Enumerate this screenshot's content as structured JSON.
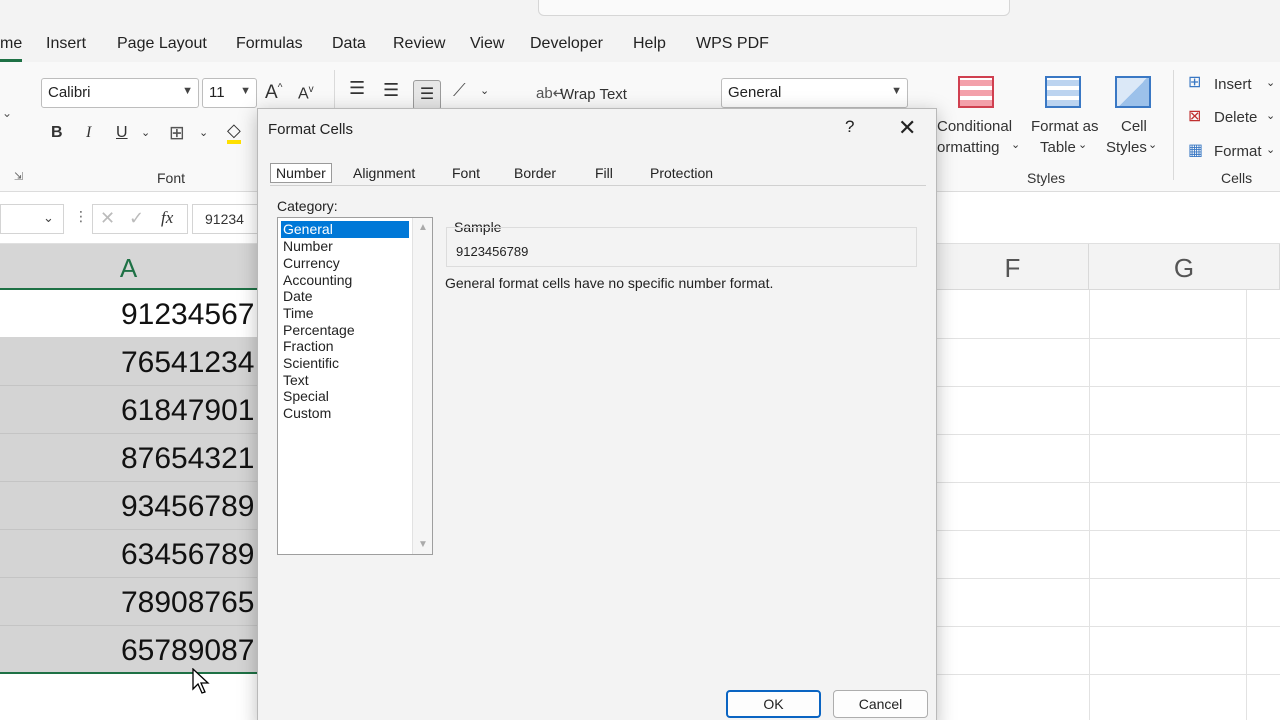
{
  "menu": {
    "tabs": [
      "me",
      "Insert",
      "Page Layout",
      "Formulas",
      "Data",
      "Review",
      "View",
      "Developer",
      "Help",
      "WPS PDF"
    ]
  },
  "ribbon": {
    "font_name": "Calibri",
    "font_size": "11",
    "bold": "B",
    "italic": "I",
    "underline": "U",
    "font_group_label": "Font",
    "wrap_text": "Wrap Text",
    "number_format": "General",
    "conditional_formatting_line1": "Conditional",
    "conditional_formatting_line2": "ormatting",
    "format_as_table_line1": "Format as",
    "format_as_table_line2": "Table",
    "cell_styles_line1": "Cell",
    "cell_styles_line2": "Styles",
    "styles_group_label": "Styles",
    "insert": "Insert",
    "delete": "Delete",
    "format": "Format",
    "cells_group_label": "Cells"
  },
  "formula_bar": {
    "fx": "fx",
    "value": "91234"
  },
  "grid": {
    "column_a": "A",
    "column_f": "F",
    "column_g": "G",
    "cells": [
      "91234567",
      "76541234",
      "61847901",
      "87654321",
      "93456789",
      "63456789",
      "78908765",
      "65789087"
    ]
  },
  "dialog": {
    "title": "Format Cells",
    "help": "?",
    "close": "✕",
    "tabs": [
      "Number",
      "Alignment",
      "Font",
      "Border",
      "Fill",
      "Protection"
    ],
    "category_label": "Category:",
    "categories": [
      "General",
      "Number",
      "Currency",
      "Accounting",
      "Date",
      "Time",
      "Percentage",
      "Fraction",
      "Scientific",
      "Text",
      "Special",
      "Custom"
    ],
    "sample_label": "Sample",
    "sample_value": "9123456789",
    "description": "General format cells have no specific number format.",
    "ok": "OK",
    "cancel": "Cancel"
  },
  "colors": {
    "excel_green": "#1e7145",
    "selection_blue": "#0078d7",
    "cell_selected": "#d4d4d4"
  }
}
